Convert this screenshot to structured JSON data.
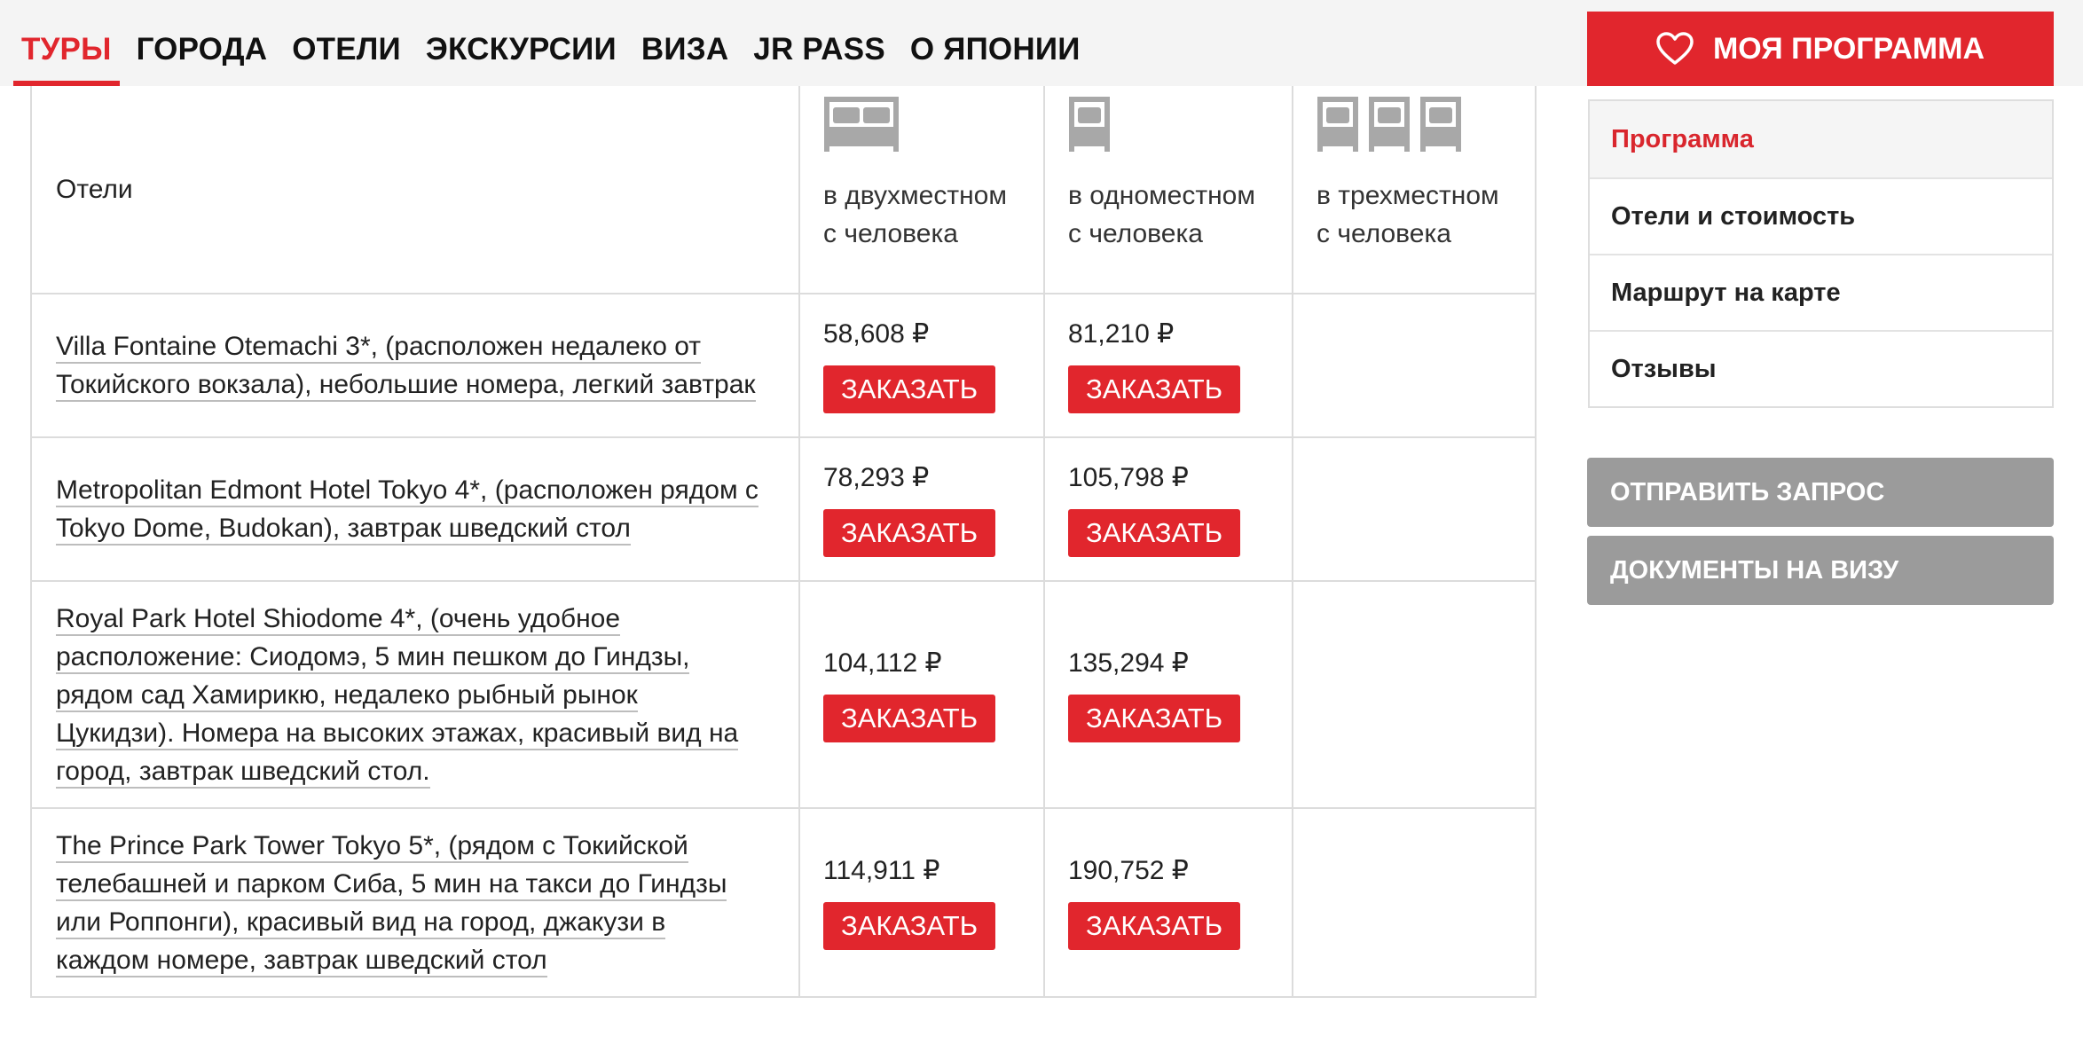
{
  "nav": {
    "items": [
      "ТУРЫ",
      "ГОРОДА",
      "ОТЕЛИ",
      "ЭКСКУРСИИ",
      "ВИЗА",
      "JR PASS",
      "О ЯПОНИИ"
    ],
    "active": "ТУРЫ",
    "my_program_label": "МОЯ ПРОГРАММА",
    "my_program_icon": "heart-icon"
  },
  "table": {
    "header": {
      "hotels_label": "Отели",
      "columns": [
        {
          "line1": "в двухместном",
          "line2": "с человека",
          "icon": "double-bed-icon"
        },
        {
          "line1": "в одноместном",
          "line2": "с человека",
          "icon": "single-bed-icon"
        },
        {
          "line1": "в трехместном",
          "line2": "с человека",
          "icon": "triple-bed-icon"
        }
      ]
    },
    "order_label": "ЗАКАЗАТЬ",
    "rows": [
      {
        "hotel_lines": [
          "Villa Fontaine Otemachi 3*, (расположен недалеко от",
          "Токийского вокзала), небольшие номера, легкий завтрак"
        ],
        "price_double": "58,608 ₽",
        "price_single": "81,210 ₽"
      },
      {
        "hotel_lines": [
          "Metropolitan Edmont Hotel Tokyo 4*, (расположен рядом с",
          "Tokyo Dome, Budokan), завтрак шведский стол"
        ],
        "price_double": "78,293 ₽",
        "price_single": "105,798 ₽"
      },
      {
        "hotel_lines": [
          "Royal Park Hotel Shiodome 4*, (очень удобное",
          "расположение: Сиодомэ, 5 мин пешком до Гиндзы,",
          "рядом сад Хамирикю, недалеко рыбный рынок",
          "Цукидзи). Номера на высоких этажах, красивый вид на",
          "город, завтрак шведский стол."
        ],
        "price_double": "104,112 ₽",
        "price_single": "135,294 ₽"
      },
      {
        "hotel_lines": [
          "The Prince Park Tower Tokyo 5*, (рядом с Токийской",
          "телебашней и парком Сиба, 5 мин на такси до Гиндзы",
          "или Роппонги), красивый вид на город, джакузи в",
          "каждом номере, завтрак шведский стол"
        ],
        "price_double": "114,911 ₽",
        "price_single": "190,752 ₽"
      }
    ]
  },
  "side_menu": {
    "items": [
      "Программа",
      "Отели и стоимость",
      "Маршрут на карте",
      "Отзывы"
    ]
  },
  "buttons": {
    "send_request": "ОТПРАВИТЬ ЗАПРОС",
    "visa_docs": "ДОКУМЕНТЫ НА ВИЗУ"
  },
  "colors": {
    "accent": "#e1262d",
    "gray_button": "#9b9b9b",
    "icon_gray": "#a8a8a8"
  }
}
